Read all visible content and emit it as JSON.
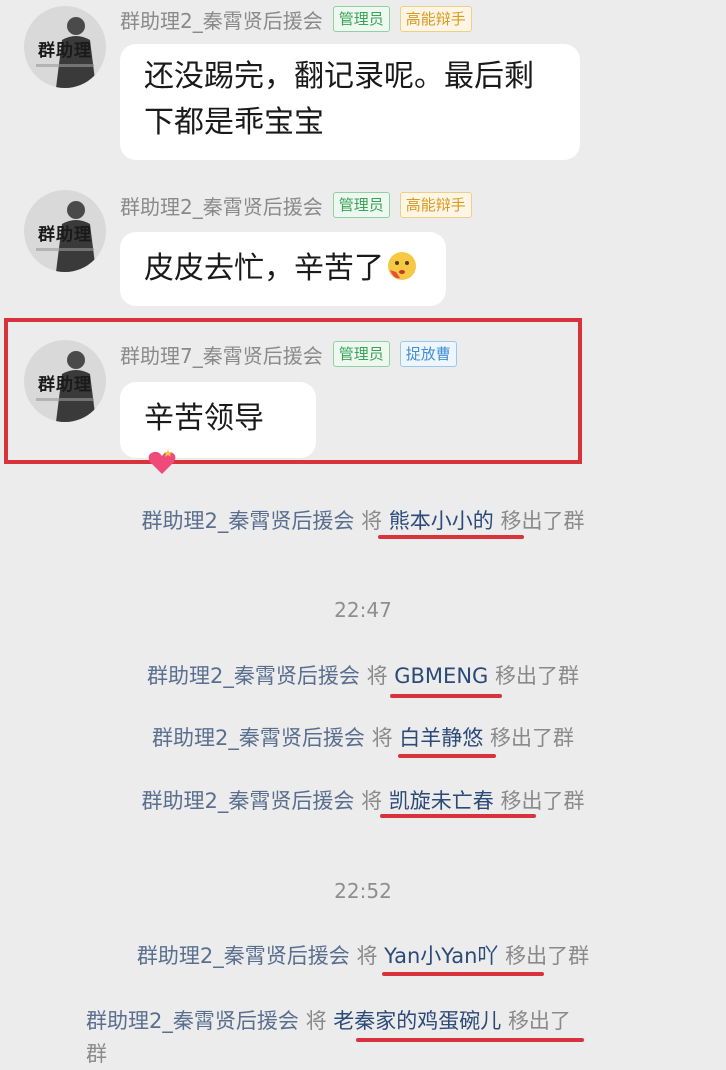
{
  "messages": [
    {
      "sender": "群助理2_秦霄贤后援会",
      "badges": [
        "管理员",
        "高能辩手"
      ],
      "text_line1": "还没踢完，翻记录呢。最后剩",
      "text_line2": "下都是乖宝宝",
      "avatar_text": "群助理"
    },
    {
      "sender": "群助理2_秦霄贤后援会",
      "badges": [
        "管理员",
        "高能辩手"
      ],
      "text": "皮皮去忙，辛苦了",
      "emoji": "blushing-face-emoji",
      "avatar_text": "群助理"
    },
    {
      "sender": "群助理7_秦霄贤后援会",
      "badges": [
        "管理员",
        "捉放曹"
      ],
      "text": "辛苦领导",
      "emoji": "heart-emoji",
      "avatar_text": "群助理"
    }
  ],
  "notices": [
    {
      "actor": "群助理2_秦霄贤后援会",
      "verb": "将",
      "target": "熊本小小的",
      "suffix": "移出了群"
    },
    {
      "actor": "群助理2_秦霄贤后援会",
      "verb": "将",
      "target": "GBMENG",
      "suffix": "移出了群"
    },
    {
      "actor": "群助理2_秦霄贤后援会",
      "verb": "将",
      "target": "白羊静悠",
      "suffix": "移出了群"
    },
    {
      "actor": "群助理2_秦霄贤后援会",
      "verb": "将",
      "target": "凯旋未亡春",
      "suffix": "移出了群"
    },
    {
      "actor": "群助理2_秦霄贤后援会",
      "verb": "将",
      "target": "Yan小Yan吖",
      "suffix": "移出了群"
    },
    {
      "actor": "群助理2_秦霄贤后援会",
      "verb": "将",
      "target": "老秦家的鸡蛋碗儿",
      "suffix": "移出了",
      "suffix2": "群"
    }
  ],
  "timestamps": [
    "22:47",
    "22:52"
  ],
  "colors": {
    "background": "#ececec",
    "bubble": "#ffffff",
    "admin_badge": "#3aa35a",
    "title_badge_orange": "#d99a20",
    "title_badge_blue": "#3f8fd6",
    "highlight_red": "#d8323a",
    "notice_name": "#2b4a78"
  }
}
